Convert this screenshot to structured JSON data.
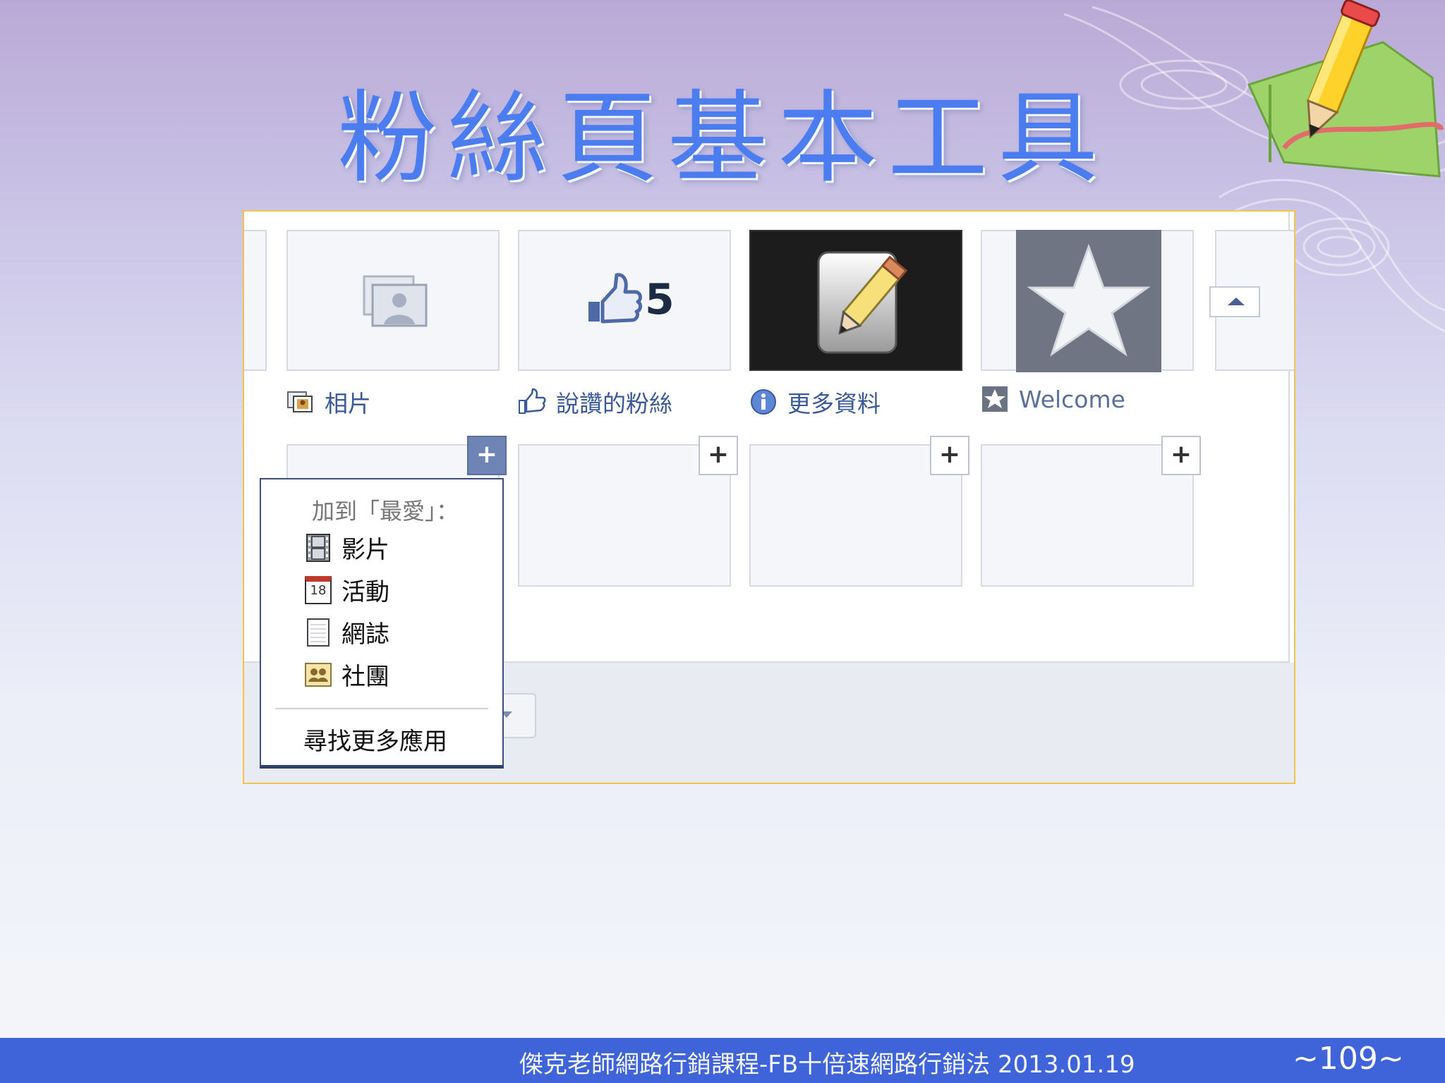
{
  "slide": {
    "title": "粉絲頁基本工具",
    "footer_text": "傑克老師網路行銷課程-FB十倍速網路行銷法 2013.01.19",
    "page_number": "~109~"
  },
  "screenshot": {
    "tiles": [
      {
        "label": "相片",
        "icon": "photos-icon"
      },
      {
        "label": "說讚的粉絲",
        "icon": "like-icon",
        "like_count": "5"
      },
      {
        "label": "更多資料",
        "icon": "info-icon"
      },
      {
        "label": "Welcome",
        "icon": "star-icon"
      }
    ],
    "add_menu": {
      "header": "加到「最愛」：",
      "items": [
        {
          "label": "影片",
          "icon": "film-icon"
        },
        {
          "label": "活動",
          "icon": "calendar-icon",
          "icon_text": "18"
        },
        {
          "label": "網誌",
          "icon": "notes-icon"
        },
        {
          "label": "社團",
          "icon": "group-icon"
        }
      ],
      "more": "尋找更多應用"
    },
    "plus_symbol": "+"
  },
  "colors": {
    "title": "#4b7df0",
    "facebook_link": "#3b5998",
    "footer_bar": "#3f63d8",
    "panel_border": "#f2c44a",
    "active_plus": "#6d84b4"
  }
}
